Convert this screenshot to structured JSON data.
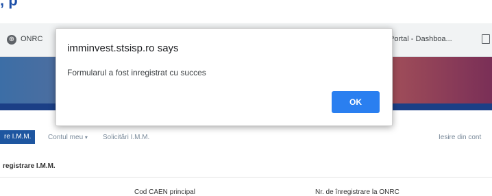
{
  "top_caption": ", p",
  "bookmarks": {
    "left_label": "ONRC",
    "right_label": "Portal - Dashboa..."
  },
  "menu": {
    "active": "re I.M.M.",
    "account": "Contul meu",
    "account_caret": "▾",
    "requests": "Solicitări I.M.M.",
    "logout": "Iesire din cont"
  },
  "section": {
    "title": "registrare I.M.M."
  },
  "fields": {
    "caen": "Cod CAEN principal",
    "onrc_number": "Nr. de înregistrare la ONRC"
  },
  "dialog": {
    "title": "imminvest.stsisp.ro says",
    "message": "Formularul a fost inregistrat cu succes",
    "ok_label": "OK"
  },
  "colors": {
    "menu_active": "#1e56a0",
    "ok_button": "#2a7ff0",
    "banner_stripe": "#1b3f86"
  }
}
